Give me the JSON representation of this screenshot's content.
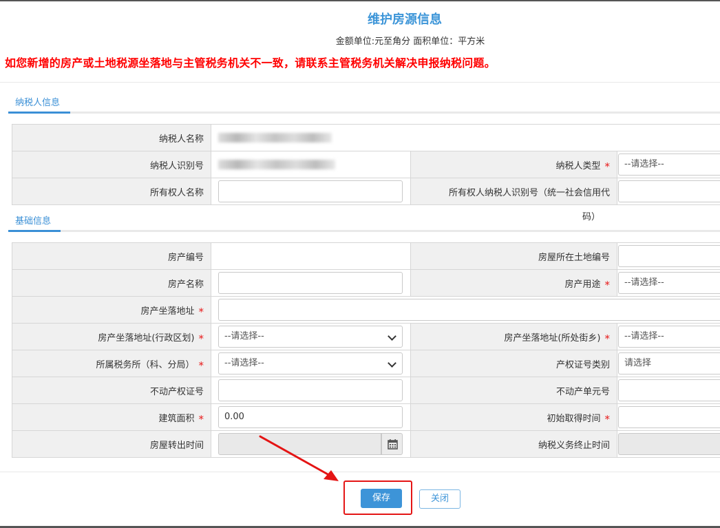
{
  "header": {
    "title": "维护房源信息",
    "unit_note": "金额单位:元至角分 面积单位：平方米",
    "warning": "如您新增的房产或土地税源坐落地与主管税务机关不一致，请联系主管税务机关解决申报纳税问题。"
  },
  "taxpayer": {
    "tab_label": "纳税人信息",
    "name_label": "纳税人名称",
    "id_label": "纳税人识别号",
    "type_label": "纳税人类型",
    "type_value": "--请选择--",
    "owner_name_label": "所有权人名称",
    "owner_id_label_line1": "所有权人纳税人识别号（统一社会信用代",
    "owner_id_label_line2": "码）"
  },
  "basic": {
    "tab_label": "基础信息",
    "property_no_label": "房产编号",
    "land_no_label": "房屋所在土地编号",
    "property_name_label": "房产名称",
    "usage_label": "房产用途",
    "usage_value": "--请选择--",
    "address_label": "房产坐落地址",
    "district_label": "房产坐落地址(行政区划)",
    "district_value": "--请选择--",
    "street_label": "房产坐落地址(所处街乡)",
    "street_value": "--请选择--",
    "tax_office_label": "所属税务所（科、分局）",
    "tax_office_value": "--请选择--",
    "cert_type_label": "产权证号类别",
    "cert_type_value": "请选择",
    "cert_no_label": "不动产权证号",
    "unit_no_label": "不动产单元号",
    "area_label": "建筑面积",
    "area_value": "0.00",
    "acquire_time_label": "初始取得时间",
    "transfer_time_label": "房屋转出时间",
    "end_time_label": "纳税义务终止时间"
  },
  "buttons": {
    "save": "保存",
    "close": "关闭"
  },
  "colors": {
    "accent": "#3d94d8",
    "warning": "#ff0000",
    "required_star": "#e81818",
    "annotation": "#e41414"
  }
}
